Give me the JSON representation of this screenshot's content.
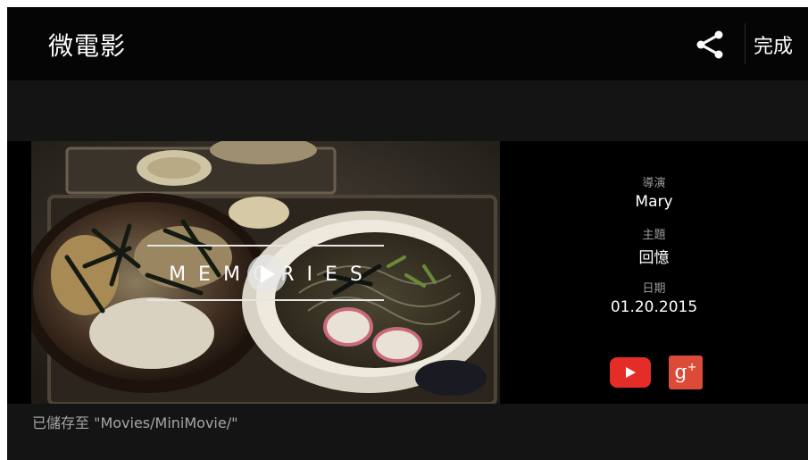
{
  "header": {
    "title": "微電影",
    "share_icon": "share-icon",
    "done_label": "完成"
  },
  "video": {
    "overlay_title": "MEMORIES",
    "play_icon": "play-icon"
  },
  "info": {
    "director_label": "導演",
    "director_value": "Mary",
    "theme_label": "主題",
    "theme_value": "回憶",
    "date_label": "日期",
    "date_value": "01.20.2015"
  },
  "share_targets": {
    "youtube_icon": "youtube-icon",
    "youtube_color": "#e52d27",
    "googleplus_icon": "google-plus-icon",
    "googleplus_color": "#dc4a38",
    "googleplus_glyph": "g",
    "googleplus_plus": "+"
  },
  "footer": {
    "saved_message": "已儲存至 \"Movies/MiniMovie/\""
  }
}
